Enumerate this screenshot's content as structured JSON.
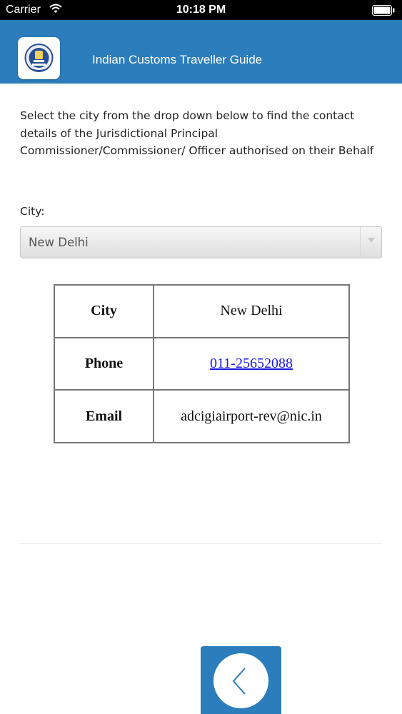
{
  "status_bar": {
    "carrier": "Carrier",
    "time": "10:18 PM",
    "wifi_icon": "wifi-icon",
    "battery_icon": "battery-icon"
  },
  "header": {
    "logo_icon": "customs-emblem-icon",
    "title": "Indian Customs Traveller Guide",
    "background_color": "#2b7dbb"
  },
  "main": {
    "intro": "Select the city from the drop down below to find the contact details of the Jurisdictional Principal Commissioner/Commissioner/ Officer authorised on their Behalf",
    "city_label": "City:",
    "city_select": {
      "value": "New Delhi",
      "icon": "chevron-down-icon"
    },
    "table": {
      "rows": [
        {
          "key": "City",
          "value": "New Delhi"
        },
        {
          "key": "Phone",
          "value": "011-25652088"
        },
        {
          "key": "Email",
          "value": "adcigiairport-rev@nic.in"
        }
      ]
    }
  },
  "footer": {
    "back_icon": "chevron-left-icon"
  }
}
